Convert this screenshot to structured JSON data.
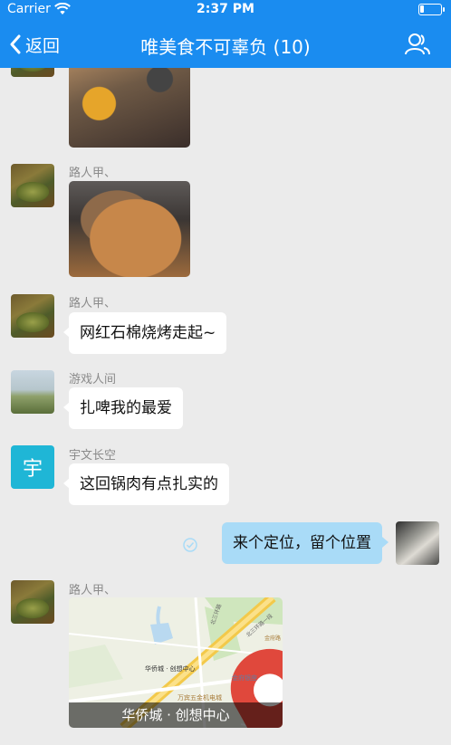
{
  "status": {
    "carrier": "Carrier",
    "time": "2:37 PM"
  },
  "nav": {
    "back_label": "返回",
    "title": "唯美食不可辜负 (10)"
  },
  "messages": [
    {
      "sender": "路人甲、",
      "type": "image",
      "content": "bbq-table-photo"
    },
    {
      "sender": "路人甲、",
      "type": "image",
      "content": "grilled-meat-photo"
    },
    {
      "sender": "路人甲、",
      "type": "text",
      "content": "网红石棉烧烤走起~"
    },
    {
      "sender": "游戏人间",
      "type": "text",
      "content": "扎啤我的最爱"
    },
    {
      "sender": "宇文长空",
      "avatar_text": "宇",
      "type": "text",
      "content": "这回锅肉有点扎实的"
    },
    {
      "sender": "",
      "type": "text",
      "self": true,
      "content": "来个定位，留个位置"
    },
    {
      "sender": "路人甲、",
      "type": "location",
      "content": "华侨城 · 创想中心",
      "map_labels": [
        "华侨城 · 创想中心",
        "万宾五金机电城",
        "金府银座",
        "北三环路一段",
        "金府路",
        "北三环路"
      ]
    }
  ],
  "colors": {
    "nav": "#1a8cf0",
    "chat_bg": "#ebebeb",
    "self_bubble": "#a9dbf7",
    "avatar_yu": "#1fb6d6"
  },
  "icons": {
    "back": "chevron-left-icon",
    "group": "group-members-icon",
    "sent": "sent-check-icon",
    "wifi": "wifi-icon",
    "battery": "battery-icon",
    "pin": "map-pin-icon"
  }
}
